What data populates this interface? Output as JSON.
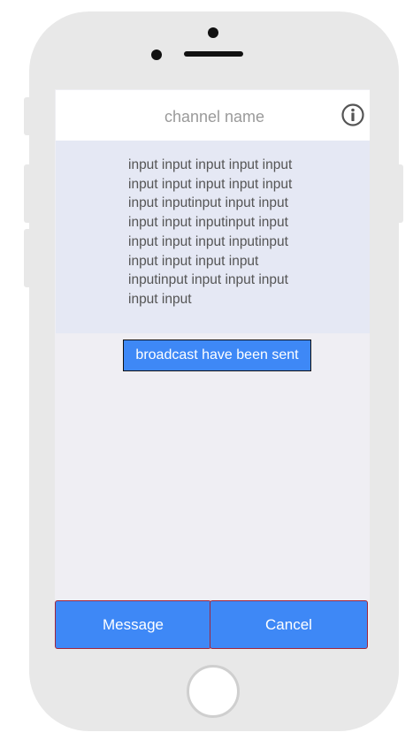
{
  "header": {
    "channel_name": "channel name",
    "info_icon": "info-icon"
  },
  "message": {
    "lines": [
      "input input input input input",
      "input input input input input",
      "input inputinput input input",
      "input input inputinput input",
      "input input input inputinput",
      "input input input input",
      "inputinput input input input",
      "input input"
    ]
  },
  "status": {
    "text": "broadcast have been sent"
  },
  "actions": {
    "message_label": "Message",
    "cancel_label": "Cancel"
  },
  "colors": {
    "accent": "#3e88f6",
    "message_background": "#e5e8f4",
    "screen_background": "#efeef3"
  }
}
